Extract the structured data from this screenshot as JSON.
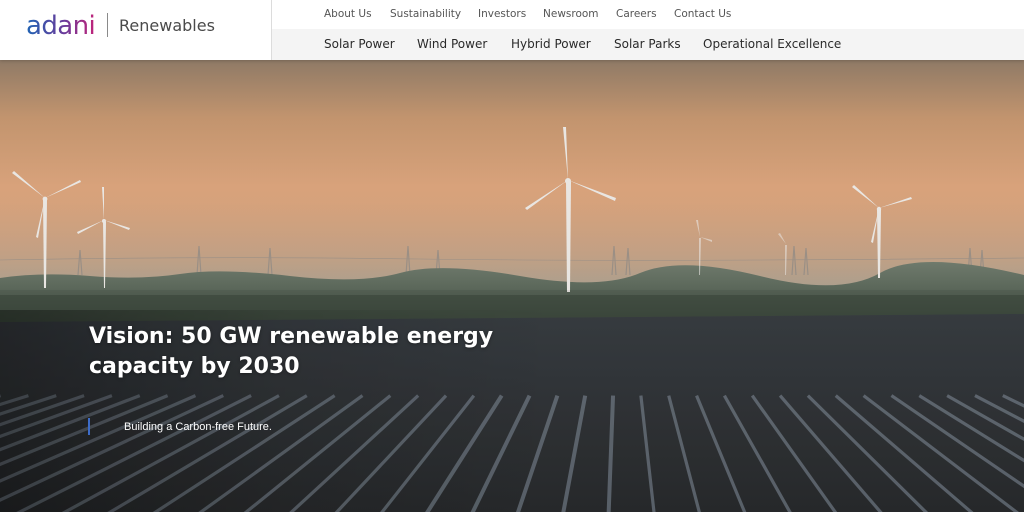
{
  "brand": {
    "logo_text": "adani",
    "division": "Renewables"
  },
  "nav": {
    "top_links": [
      "About Us",
      "Sustainability",
      "Investors",
      "Newsroom",
      "Careers",
      "Contact Us"
    ],
    "main_links": [
      "Solar Power",
      "Wind Power",
      "Hybrid Power",
      "Solar Parks",
      "Operational Excellence"
    ]
  },
  "hero": {
    "title": "Vision: 50 GW renewable energy capacity by 2030",
    "subtitle": "Building a Carbon-free Future.",
    "image_alt": "wind turbines and solar panels at dusk"
  },
  "colors": {
    "logo_gradient_start": "#1f64b4",
    "logo_gradient_mid": "#6a3a9a",
    "logo_gradient_end": "#c0247a",
    "subtitle_accent": "#3d6cc8",
    "nav_main_background": "#f4f4f4"
  }
}
